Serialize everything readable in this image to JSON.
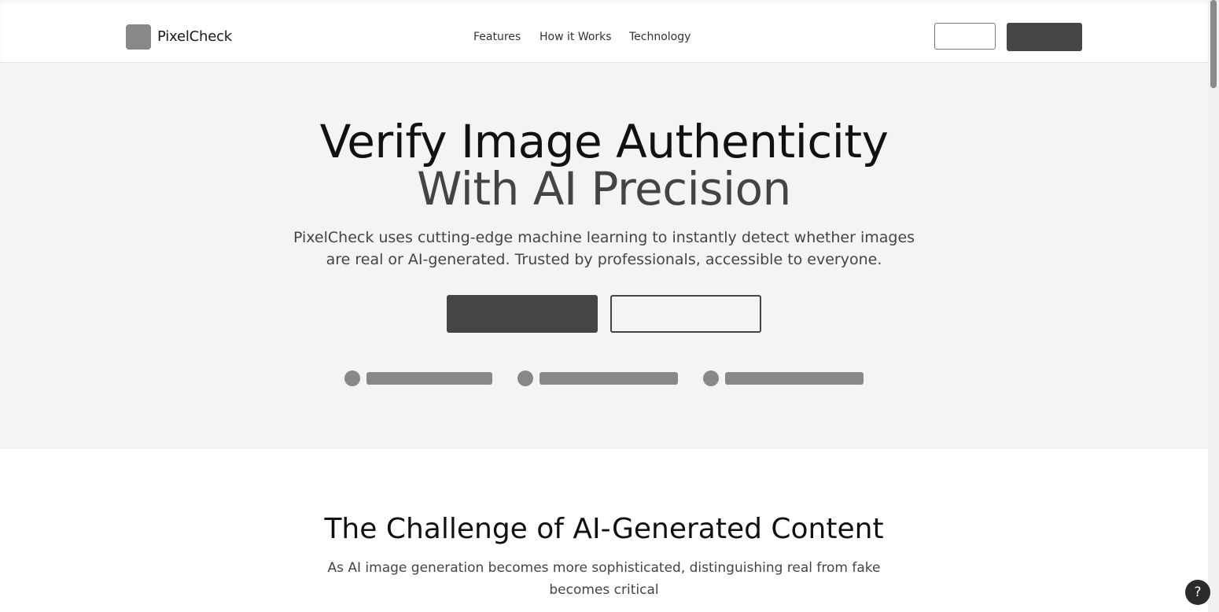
{
  "brand": {
    "name": "PixelCheck"
  },
  "nav": {
    "features": "Features",
    "how_it_works": "How it Works",
    "technology": "Technology"
  },
  "hero": {
    "title_line1": "Verify Image Authenticity",
    "title_line2": "With AI Precision",
    "subtitle": "PixelCheck uses cutting-edge machine learning to instantly detect whether images are real or AI-generated. Trusted by professionals, accessible to everyone."
  },
  "challenge": {
    "title": "The Challenge of AI-Generated Content",
    "subtitle": "As AI image generation becomes more sophisticated, distinguishing real from fake becomes critical"
  },
  "help": {
    "label": "?"
  },
  "colors": {
    "dark_button": "#454545",
    "placeholder_gray": "#888888",
    "hero_bg": "#f4f4f4"
  }
}
